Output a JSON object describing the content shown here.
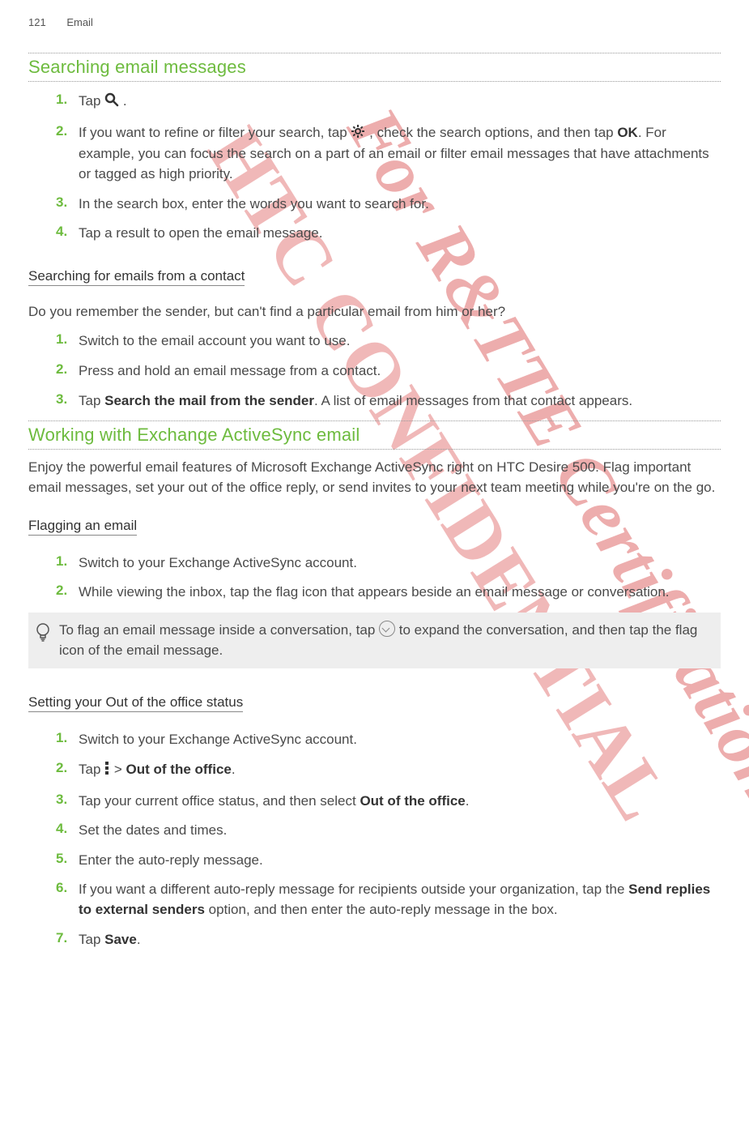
{
  "header": {
    "page_number": "121",
    "chapter": "Email"
  },
  "watermarks": {
    "w1": "HTC CONFIDENTIAL",
    "w2": "For R&TTE Certification only"
  },
  "section1": {
    "title": "Searching email messages",
    "steps": [
      {
        "n": "1.",
        "pre": "Tap ",
        "post": " ."
      },
      {
        "n": "2.",
        "t1": "If you want to refine or filter your search, tap ",
        "t2": ", check the search options, and then tap ",
        "ok": "OK",
        "t3": ". For example, you can focus the search on a part of an email or filter email messages that have attachments or tagged as high priority."
      },
      {
        "n": "3.",
        "text": "In the search box, enter the words you want to search for."
      },
      {
        "n": "4.",
        "text": "Tap a result to open the email message."
      }
    ],
    "sub1": {
      "heading": "Searching for emails from a contact",
      "intro": "Do you remember the sender, but can't find a particular email from him or her?",
      "steps": [
        {
          "n": "1.",
          "text": "Switch to the email account you want to use."
        },
        {
          "n": "2.",
          "text": "Press and hold an email message from a contact."
        },
        {
          "n": "3.",
          "t1": "Tap ",
          "bold": "Search the mail from the sender",
          "t2": ". A list of email messages from that contact appears."
        }
      ]
    }
  },
  "section2": {
    "title": "Working with Exchange ActiveSync email",
    "intro": "Enjoy the powerful email features of Microsoft Exchange ActiveSync right on HTC Desire 500. Flag important email messages, set your out of the office reply, or send invites to your next team meeting while you're on the go.",
    "sub1": {
      "heading": "Flagging an email",
      "steps": [
        {
          "n": "1.",
          "text": "Switch to your Exchange ActiveSync account."
        },
        {
          "n": "2.",
          "text": "While viewing the inbox, tap the flag icon that appears beside an email message or conversation."
        }
      ],
      "tip": {
        "t1": "To flag an email message inside a conversation, tap ",
        "t2": " to expand the conversation, and then tap the flag icon of the email message."
      }
    },
    "sub2": {
      "heading": "Setting your Out of the office status",
      "steps": [
        {
          "n": "1.",
          "text": "Switch to your Exchange ActiveSync account."
        },
        {
          "n": "2.",
          "t1": "Tap ",
          "t2": " > ",
          "bold": "Out of the office",
          "t3": "."
        },
        {
          "n": "3.",
          "t1": "Tap your current office status, and then select ",
          "bold": "Out of the office",
          "t2": "."
        },
        {
          "n": "4.",
          "text": "Set the dates and times."
        },
        {
          "n": "5.",
          "text": "Enter the auto-reply message."
        },
        {
          "n": "6.",
          "t1": "If you want a different auto-reply message for recipients outside your organization, tap the ",
          "bold": "Send replies to external senders",
          "t2": " option, and then enter the auto-reply message in the box."
        },
        {
          "n": "7.",
          "t1": "Tap ",
          "bold": "Save",
          "t2": "."
        }
      ]
    }
  }
}
